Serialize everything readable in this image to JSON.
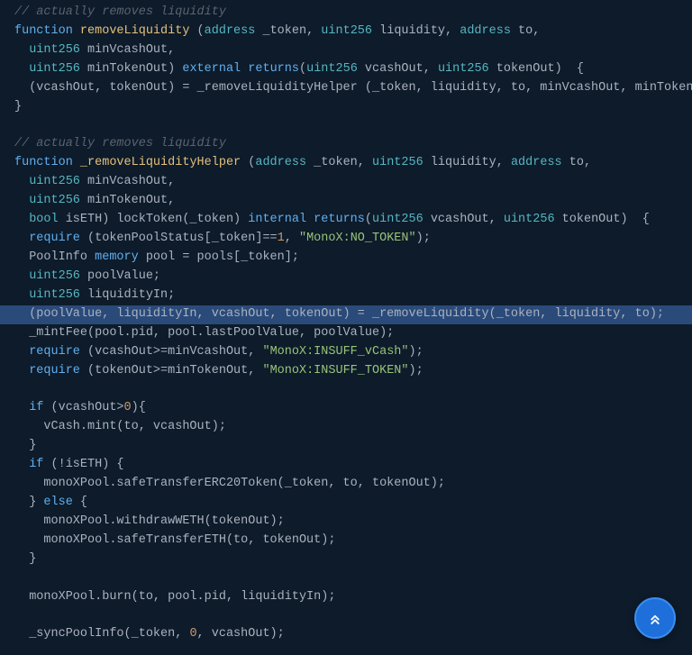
{
  "code": {
    "c1": "// actually removes liquidity",
    "l1_function": "function",
    "l1_funcname": "removeLiquidity",
    "l1_lp": " (",
    "l1_addr": "address",
    "l1_tok": " _token, ",
    "l1_u256a": "uint256",
    "l1_liq": " liquidity, ",
    "l1_addr2": "address",
    "l1_to": " to,",
    "l2_u256": "uint256",
    "l2_min": " minVcashOut,",
    "l3_u256": "uint256",
    "l3_min": " minTokenOut) ",
    "l3_ext": "external",
    "l3_sp": " ",
    "l3_ret": "returns",
    "l3_lp": "(",
    "l3_u256b": "uint256",
    "l3_vc": " vcashOut, ",
    "l3_u256c": "uint256",
    "l3_to": " tokenOut)  {",
    "l4": "  (vcashOut, tokenOut) = _removeLiquidityHelper (_token, liquidity, to, minVcashOut, minToken",
    "l5": "}",
    "c2": "// actually removes liquidity",
    "l7_function": "function",
    "l7_funcname": "_removeLiquidityHelper",
    "l7_lp": " (",
    "l7_addr": "address",
    "l7_tok": " _token, ",
    "l7_u256": "uint256",
    "l7_liq": " liquidity, ",
    "l7_addr2": "address",
    "l7_to": " to,",
    "l8_u256": "uint256",
    "l8_min": " minVcashOut,",
    "l9_u256": "uint256",
    "l9_min": " minTokenOut,",
    "l10_bool": "bool",
    "l10_eth": " isETH) lockToken(_token) ",
    "l10_int": "internal",
    "l10_sp": " ",
    "l10_ret": "returns",
    "l10_lp": "(",
    "l10_u256a": "uint256",
    "l10_vc": " vcashOut, ",
    "l10_u256b": "uint256",
    "l10_to": " tokenOut)  {",
    "l11_req": "require",
    "l11_body": " (tokenPoolStatus[_token]==",
    "l11_num": "1",
    "l11_comma": ", ",
    "l11_str": "\"MonoX:NO_TOKEN\"",
    "l11_end": ");",
    "l12a": "  PoolInfo ",
    "l12_mem": "memory",
    "l12b": " pool = pools[_token];",
    "l13_u256": "uint256",
    "l13_pv": " poolValue;",
    "l14_u256": "uint256",
    "l14_li": " liquidityIn;",
    "l15": "  (poolValue, liquidityIn, vcashOut, tokenOut) = _removeLiquidity(_token, liquidity, to);",
    "l16": "  _mintFee(pool.pid, pool.lastPoolValue, poolValue);",
    "l17_req": "require",
    "l17_body": " (vcashOut>=minVcashOut, ",
    "l17_str": "\"MonoX:INSUFF_vCash\"",
    "l17_end": ");",
    "l18_req": "require",
    "l18_body": " (tokenOut>=minTokenOut, ",
    "l18_str": "\"MonoX:INSUFF_TOKEN\"",
    "l18_end": ");",
    "l20_if": "if",
    "l20_body": " (vcashOut>",
    "l20_num": "0",
    "l20_end": "){",
    "l21": "    vCash.mint(to, vcashOut);",
    "l22": "  }",
    "l23_if": "if",
    "l23_body": " (!isETH) {",
    "l24": "    monoXPool.safeTransferERC20Token(_token, to, tokenOut);",
    "l25a": "  } ",
    "l25_else": "else",
    "l25b": " {",
    "l26": "    monoXPool.withdrawWETH(tokenOut);",
    "l27": "    monoXPool.safeTransferETH(to, tokenOut);",
    "l28": "  }",
    "l30": "  monoXPool.burn(to, pool.pid, liquidityIn);",
    "l32a": "  _syncPoolInfo(_token, ",
    "l32_num": "0",
    "l32b": ", vcashOut);"
  },
  "button": {
    "name": "scroll-to-top"
  }
}
